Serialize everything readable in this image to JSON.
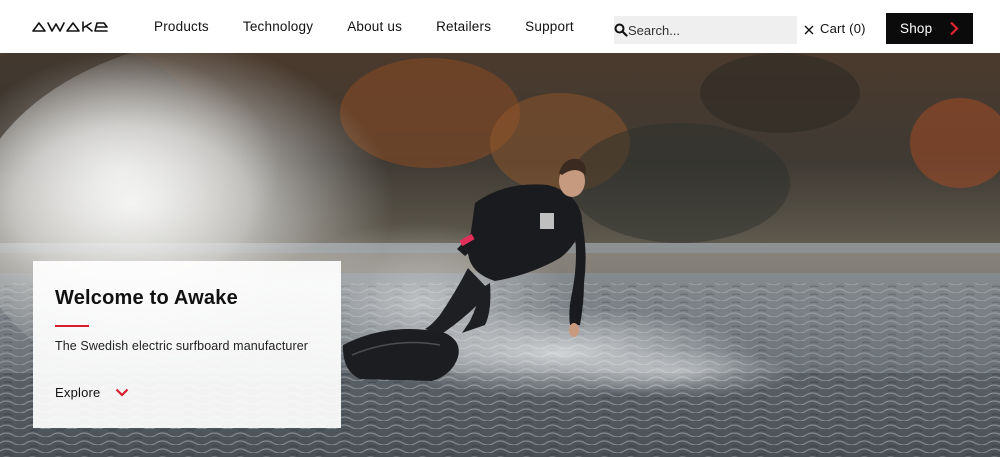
{
  "brand": {
    "name": "awake",
    "accent_color": "#d6212b"
  },
  "nav": {
    "items": [
      {
        "label": "Products"
      },
      {
        "label": "Technology"
      },
      {
        "label": "About us"
      },
      {
        "label": "Retailers"
      },
      {
        "label": "Support"
      }
    ]
  },
  "search": {
    "placeholder": "Search...",
    "value": "",
    "icon": "search-icon",
    "clear_icon": "close-icon"
  },
  "cart": {
    "label": "Cart (0)"
  },
  "shop": {
    "label": "Shop",
    "icon": "chevron-right-icon"
  },
  "hero": {
    "title": "Welcome to Awake",
    "subtitle": "The Swedish electric surfboard manufacturer",
    "cta_label": "Explore",
    "cta_icon": "chevron-down-icon"
  }
}
